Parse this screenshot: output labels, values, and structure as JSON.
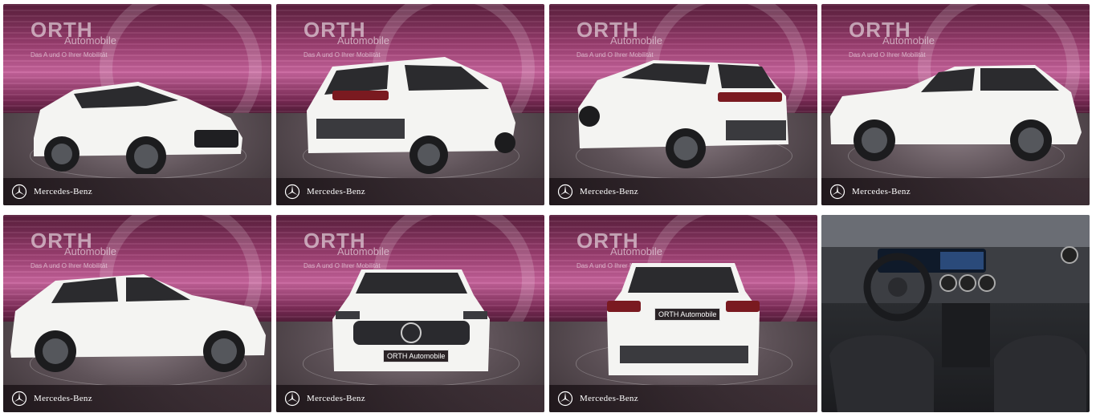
{
  "gallery": {
    "tiles": [
      {
        "id": 1,
        "view": "front-three-quarter",
        "dealer": {
          "brand": "ORTH",
          "sub": "Automobile",
          "tagline": "Das A und O Ihrer Mobilität"
        },
        "footer": "Mercedes-Benz"
      },
      {
        "id": 2,
        "view": "rear-three-quarter-left",
        "dealer": {
          "brand": "ORTH",
          "sub": "Automobile",
          "tagline": "Das A und O Ihrer Mobilität"
        },
        "footer": "Mercedes-Benz"
      },
      {
        "id": 3,
        "view": "rear-three-quarter-right",
        "dealer": {
          "brand": "ORTH",
          "sub": "Automobile",
          "tagline": "Das A und O Ihrer Mobilität"
        },
        "footer": "Mercedes-Benz"
      },
      {
        "id": 4,
        "view": "side-left",
        "dealer": {
          "brand": "ORTH",
          "sub": "Automobile",
          "tagline": "Das A und O Ihrer Mobilität"
        },
        "footer": "Mercedes-Benz"
      },
      {
        "id": 5,
        "view": "side-right",
        "dealer": {
          "brand": "ORTH",
          "sub": "Automobile",
          "tagline": "Das A und O Ihrer Mobilität"
        },
        "footer": "Mercedes-Benz"
      },
      {
        "id": 6,
        "view": "front",
        "dealer": {
          "brand": "ORTH",
          "sub": "Automobile",
          "tagline": "Das A und O Ihrer Mobilität"
        },
        "footer": "Mercedes-Benz",
        "plate": "ORTH Automobile"
      },
      {
        "id": 7,
        "view": "rear",
        "dealer": {
          "brand": "ORTH",
          "sub": "Automobile",
          "tagline": "Das A und O Ihrer Mobilität"
        },
        "footer": "Mercedes-Benz",
        "plate": "ORTH Automobile"
      },
      {
        "id": 8,
        "view": "interior-dashboard"
      }
    ]
  },
  "colors": {
    "backdrop_magenta": "#9c3f71",
    "car_white": "#f4f4f2",
    "footer_bar": "#2a2326"
  },
  "icons": {
    "footer_logo": "mercedes-star-icon"
  }
}
